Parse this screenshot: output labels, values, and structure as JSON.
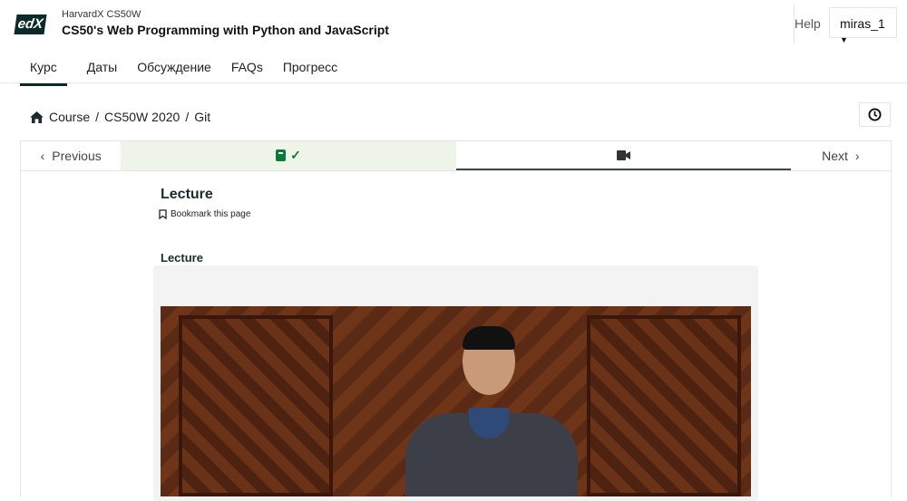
{
  "header": {
    "logo": "edX",
    "org": "HarvardX CS50W",
    "course_title": "CS50's Web Programming with Python and JavaScript",
    "help": "Help",
    "username": "miras_1"
  },
  "tabs": [
    {
      "label": "Курс",
      "active": true
    },
    {
      "label": "Даты"
    },
    {
      "label": "Обсуждение"
    },
    {
      "label": "FAQs"
    },
    {
      "label": "Прогресс"
    }
  ],
  "breadcrumb": [
    "Course",
    "CS50W 2020",
    "Git"
  ],
  "sequence": {
    "previous": "Previous",
    "next": "Next"
  },
  "unit": {
    "title": "Lecture",
    "bookmark": "Bookmark this page",
    "component_title": "Lecture"
  },
  "colors": {
    "complete_bg": "#eef5e8",
    "complete_icon": "#0a7a3b",
    "brand": "#0d2a2a"
  }
}
